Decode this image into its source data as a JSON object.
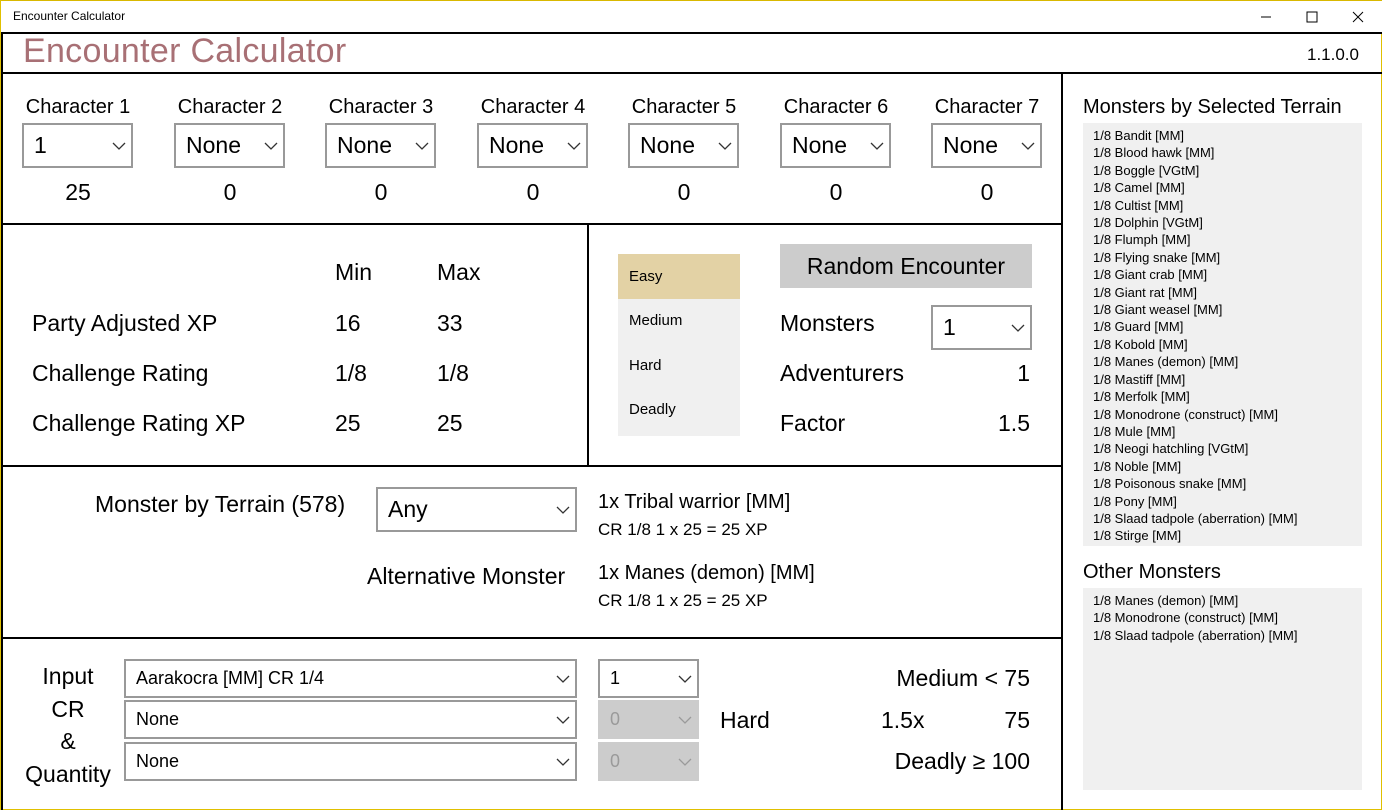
{
  "window": {
    "title": "Encounter Calculator",
    "controls": [
      "—",
      "☐",
      "✕"
    ]
  },
  "header": {
    "app_title": "Encounter Calculator",
    "version": "1.1.0.0"
  },
  "characters": [
    {
      "label": "Character 1",
      "level": "1",
      "xp": "25"
    },
    {
      "label": "Character 2",
      "level": "None",
      "xp": "0"
    },
    {
      "label": "Character 3",
      "level": "None",
      "xp": "0"
    },
    {
      "label": "Character 4",
      "level": "None",
      "xp": "0"
    },
    {
      "label": "Character 5",
      "level": "None",
      "xp": "0"
    },
    {
      "label": "Character 6",
      "level": "None",
      "xp": "0"
    },
    {
      "label": "Character 7",
      "level": "None",
      "xp": "0"
    }
  ],
  "stats": {
    "min_header": "Min",
    "max_header": "Max",
    "rows": [
      {
        "label": "Party Adjusted XP",
        "min": "16",
        "max": "33"
      },
      {
        "label": "Challenge Rating",
        "min": "1/8",
        "max": "1/8"
      },
      {
        "label": "Challenge Rating XP",
        "min": "25",
        "max": "25"
      }
    ]
  },
  "difficulty": {
    "options": [
      "Easy",
      "Medium",
      "Hard",
      "Deadly"
    ],
    "selected": "Easy",
    "selected_color": "#e3d2a5"
  },
  "encounter": {
    "random_button": "Random Encounter",
    "monsters_label": "Monsters",
    "monsters_value": "1",
    "adventurers_label": "Adventurers",
    "adventurers_value": "1",
    "factor_label": "Factor",
    "factor_value": "1.5"
  },
  "terrain": {
    "label": "Monster by Terrain (578)",
    "selected": "Any",
    "monster_name": "1x Tribal warrior [MM]",
    "monster_detail": "CR 1/8   1 x 25 = 25 XP",
    "alt_label": "Alternative Monster",
    "alt_name": "1x Manes (demon) [MM]",
    "alt_detail": "CR 1/8   1 x 25 = 25 XP"
  },
  "input_cr": {
    "label_lines": [
      "Input",
      "CR",
      "&",
      "Quantity"
    ],
    "rows": [
      {
        "monster": "Aarakocra [MM] CR 1/4",
        "qty": "1",
        "enabled": true
      },
      {
        "monster": "None",
        "qty": "0",
        "enabled": false
      },
      {
        "monster": "None",
        "qty": "0",
        "enabled": false
      }
    ],
    "result_label": "Hard",
    "medium_text": "Medium < 75",
    "multiplier": "1.5x",
    "adjusted": "75",
    "deadly_text": "Deadly ≥ 100"
  },
  "sidebar": {
    "terrain_title": "Monsters by Selected Terrain",
    "terrain_monsters": [
      "1/8 Bandit [MM]",
      "1/8 Blood hawk [MM]",
      "1/8 Boggle [VGtM]",
      "1/8 Camel [MM]",
      "1/8 Cultist [MM]",
      "1/8 Dolphin [VGtM]",
      "1/8 Flumph [MM]",
      "1/8 Flying snake [MM]",
      "1/8 Giant crab [MM]",
      "1/8 Giant rat [MM]",
      "1/8 Giant weasel [MM]",
      "1/8 Guard [MM]",
      "1/8 Kobold [MM]",
      "1/8 Manes (demon) [MM]",
      "1/8 Mastiff [MM]",
      "1/8 Merfolk [MM]",
      "1/8 Monodrone (construct) [MM]",
      "1/8 Mule [MM]",
      "1/8 Neogi hatchling [VGtM]",
      "1/8 Noble [MM]",
      "1/8 Poisonous snake [MM]",
      "1/8 Pony [MM]",
      "1/8 Slaad tadpole (aberration) [MM]",
      "1/8 Stirge [MM]"
    ],
    "other_title": "Other Monsters",
    "other_monsters": [
      "1/8 Manes (demon) [MM]",
      "1/8 Monodrone (construct) [MM]",
      "1/8 Slaad tadpole (aberration) [MM]"
    ]
  }
}
